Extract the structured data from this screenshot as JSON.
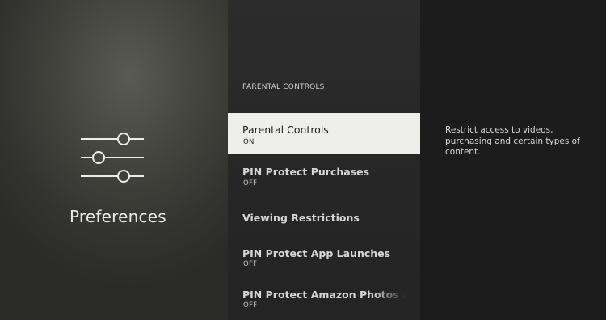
{
  "preferences": {
    "title": "Preferences",
    "icon": "sliders-icon"
  },
  "menu": {
    "header": "PARENTAL CONTROLS",
    "items": [
      {
        "label": "Parental Controls",
        "status": "ON",
        "selected": true
      },
      {
        "label": "PIN Protect Purchases",
        "status": "OFF"
      },
      {
        "label": "Viewing Restrictions",
        "status": ""
      },
      {
        "label": "PIN Protect App Launches",
        "status": "OFF"
      },
      {
        "label": "PIN Protect Amazon Photos Ap",
        "status": "OFF"
      }
    ]
  },
  "description": {
    "text": "Restrict access to videos, purchasing and certain types of content."
  },
  "colors": {
    "selected_background": "#eeeeea",
    "description_background": "#1c1c1c"
  }
}
